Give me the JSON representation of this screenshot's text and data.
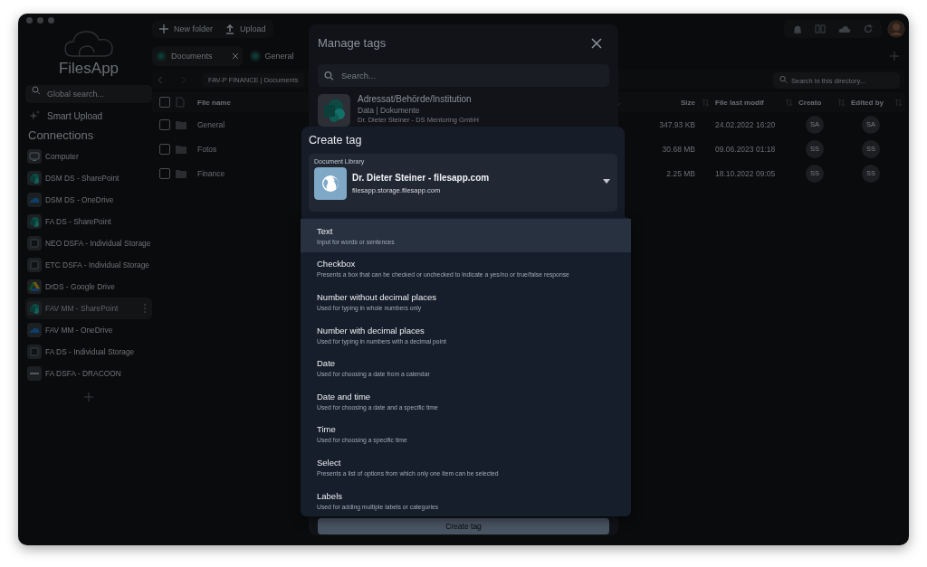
{
  "toolbar": {
    "buttons": [
      {
        "label": "New folder",
        "kind": "add"
      },
      {
        "label": "Upload",
        "kind": "upload"
      }
    ]
  },
  "sidebar": {
    "logo": "FilesApp",
    "search_placeholder": "Global search...",
    "smart_upload": "Smart Upload",
    "connections_title": "Connections",
    "connections": [
      {
        "label": "Computer",
        "kind": "computer",
        "selected": false
      },
      {
        "label": "DSM DS - SharePoint",
        "kind": "sharepoint",
        "selected": false
      },
      {
        "label": "DSM DS - OneDrive",
        "kind": "onedrive",
        "selected": false
      },
      {
        "label": "FA DS - SharePoint",
        "kind": "sharepoint",
        "selected": false
      },
      {
        "label": "NEO DSFA - Individual Storage",
        "kind": "storage",
        "selected": false
      },
      {
        "label": "ETC DSFA - Individual Storage",
        "kind": "storage",
        "selected": false
      },
      {
        "label": "DrDS - Google Drive",
        "kind": "gdrive",
        "selected": false
      },
      {
        "label": "FAV MM - SharePoint",
        "kind": "sharepoint",
        "selected": true
      },
      {
        "label": "FAV MM - OneDrive",
        "kind": "onedrive",
        "selected": false
      },
      {
        "label": "FA DS - Individual Storage",
        "kind": "storage",
        "selected": false
      },
      {
        "label": "FA DSFA - DRACOON",
        "kind": "dracoon",
        "selected": false
      }
    ]
  },
  "tabs": [
    {
      "label": "Documents",
      "selected": true
    },
    {
      "label": "General",
      "selected": false
    }
  ],
  "breadcrumb": "FAV-P FINANCE | Documents",
  "directory_search": {
    "placeholder": "Search in this directory..."
  },
  "table": {
    "select_all_checked": false,
    "columns": [
      "File name",
      "Size",
      "File last modif",
      "Creato",
      "Edited by"
    ],
    "rows": [
      {
        "name": "General",
        "size": "347.93 KB",
        "modified": "24.02.2022 16:20",
        "creator": "SA",
        "editor": "SA",
        "checked": false
      },
      {
        "name": "Fotos",
        "size": "30.68 MB",
        "modified": "09.06.2023 01:18",
        "creator": "SS",
        "editor": "SS",
        "checked": false
      },
      {
        "name": "Finance",
        "size": "2.25 MB",
        "modified": "18.10.2022 09:05",
        "creator": "SS",
        "editor": "SS",
        "checked": false
      }
    ]
  },
  "manage_tags": {
    "title": "Manage tags",
    "search_placeholder": "Search...",
    "tags": [
      {
        "name": "Adressat/Behörde/Institution",
        "source": "Data | Dokumente",
        "owner": "Dr. Dieter Steiner - DS Mentoring GmbH"
      }
    ],
    "create_button": "Create tag"
  },
  "create_tag": {
    "title": "Create tag",
    "library": {
      "label": "Document Library",
      "name": "Dr. Dieter Steiner - filesapp.com",
      "host": "filesapp.storage.filesapp.com"
    },
    "types": [
      {
        "name": "Text",
        "description": "Input for words or sentences",
        "selected": true
      },
      {
        "name": "Checkbox",
        "description": "Presents a box that can be checked or unchecked to indicate a yes/no or true/false response",
        "selected": false
      },
      {
        "name": "Number without decimal places",
        "description": "Used for typing in whole numbers only",
        "selected": false
      },
      {
        "name": "Number with decimal places",
        "description": "Used for typing in numbers with a decimal point",
        "selected": false
      },
      {
        "name": "Date",
        "description": "Used for choosing a date from a calendar",
        "selected": false
      },
      {
        "name": "Date and time",
        "description": "Used for choosing a date and a specific time",
        "selected": false
      },
      {
        "name": "Time",
        "description": "Used for choosing a specific time",
        "selected": false
      },
      {
        "name": "Select",
        "description": "Presents a list of options from which only one item can be selected",
        "selected": false
      },
      {
        "name": "Labels",
        "description": "Used for adding multiple labels or categories",
        "selected": false
      }
    ]
  }
}
